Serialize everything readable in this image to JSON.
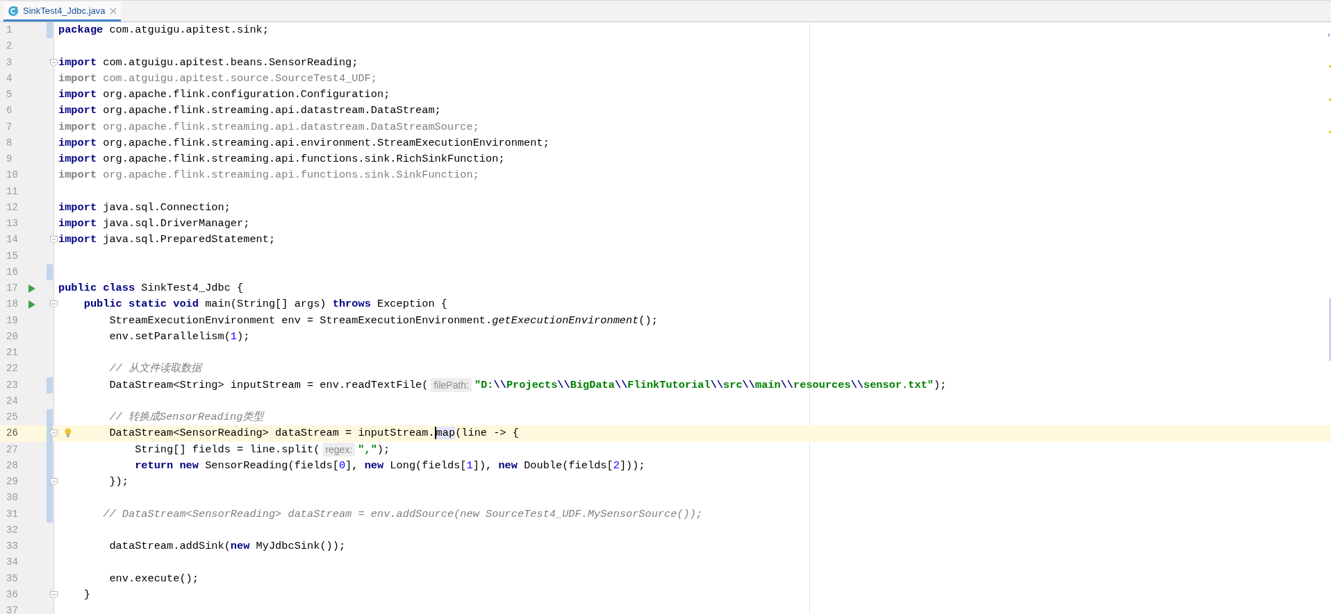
{
  "tabs": [
    {
      "label": "SinkTest4_Jdbc.java",
      "selected": true
    }
  ],
  "lines": [
    {
      "number": "1",
      "changed": true,
      "fold": false,
      "run": false,
      "current": false,
      "bulb": false,
      "tokens": [
        {
          "kind": "keyword",
          "text": "package"
        },
        {
          "kind": "plain",
          "text": " com.atguigu.apitest.sink;"
        }
      ]
    },
    {
      "number": "2",
      "changed": false,
      "fold": false,
      "run": false,
      "current": false,
      "bulb": false
    },
    {
      "number": "3",
      "changed": false,
      "fold": true,
      "run": false,
      "current": false,
      "bulb": false,
      "tokens": [
        {
          "kind": "keyword",
          "text": "import"
        },
        {
          "kind": "plain",
          "text": " com.atguigu.apitest.beans.SensorReading;"
        }
      ]
    },
    {
      "number": "4",
      "changed": false,
      "fold": false,
      "run": false,
      "current": false,
      "bulb": false,
      "tokens": [
        {
          "kind": "unused_keyword",
          "text": "import"
        },
        {
          "kind": "unused",
          "text": " com.atguigu.apitest.source.SourceTest4_UDF;"
        }
      ]
    },
    {
      "number": "5",
      "changed": false,
      "fold": false,
      "run": false,
      "current": false,
      "bulb": false,
      "tokens": [
        {
          "kind": "keyword",
          "text": "import"
        },
        {
          "kind": "plain",
          "text": " org.apache.flink.configuration.Configuration;"
        }
      ]
    },
    {
      "number": "6",
      "changed": false,
      "fold": false,
      "run": false,
      "current": false,
      "bulb": false,
      "tokens": [
        {
          "kind": "keyword",
          "text": "import"
        },
        {
          "kind": "plain",
          "text": " org.apache.flink.streaming.api.datastream.DataStream;"
        }
      ]
    },
    {
      "number": "7",
      "changed": false,
      "fold": false,
      "run": false,
      "current": false,
      "bulb": false,
      "tokens": [
        {
          "kind": "unused_keyword",
          "text": "import"
        },
        {
          "kind": "unused",
          "text": " org.apache.flink.streaming.api.datastream.DataStreamSource;"
        }
      ]
    },
    {
      "number": "8",
      "changed": false,
      "fold": false,
      "run": false,
      "current": false,
      "bulb": false,
      "tokens": [
        {
          "kind": "keyword",
          "text": "import"
        },
        {
          "kind": "plain",
          "text": " org.apache.flink.streaming.api.environment.StreamExecutionEnvironment;"
        }
      ]
    },
    {
      "number": "9",
      "changed": false,
      "fold": false,
      "run": false,
      "current": false,
      "bulb": false,
      "tokens": [
        {
          "kind": "keyword",
          "text": "import"
        },
        {
          "kind": "plain",
          "text": " org.apache.flink.streaming.api.functions.sink.RichSinkFunction;"
        }
      ]
    },
    {
      "number": "10",
      "changed": false,
      "fold": false,
      "run": false,
      "current": false,
      "bulb": false,
      "tokens": [
        {
          "kind": "unused_keyword",
          "text": "import"
        },
        {
          "kind": "unused",
          "text": " org.apache.flink.streaming.api.functions.sink.SinkFunction;"
        }
      ]
    },
    {
      "number": "11",
      "changed": false,
      "fold": false,
      "run": false,
      "current": false,
      "bulb": false
    },
    {
      "number": "12",
      "changed": false,
      "fold": false,
      "run": false,
      "current": false,
      "bulb": false,
      "tokens": [
        {
          "kind": "keyword",
          "text": "import"
        },
        {
          "kind": "plain",
          "text": " java.sql.Connection;"
        }
      ]
    },
    {
      "number": "13",
      "changed": false,
      "fold": false,
      "run": false,
      "current": false,
      "bulb": false,
      "tokens": [
        {
          "kind": "keyword",
          "text": "import"
        },
        {
          "kind": "plain",
          "text": " java.sql.DriverManager;"
        }
      ]
    },
    {
      "number": "14",
      "changed": false,
      "fold": true,
      "run": false,
      "current": false,
      "bulb": false,
      "tokens": [
        {
          "kind": "keyword",
          "text": "import"
        },
        {
          "kind": "plain",
          "text": " java.sql.PreparedStatement;"
        }
      ]
    },
    {
      "number": "15",
      "changed": false,
      "fold": false,
      "run": false,
      "current": false,
      "bulb": false
    },
    {
      "number": "16",
      "changed": true,
      "fold": false,
      "run": false,
      "current": false,
      "bulb": false
    },
    {
      "number": "17",
      "changed": false,
      "fold": false,
      "run": true,
      "current": false,
      "bulb": false,
      "tokens": [
        {
          "kind": "keyword",
          "text": "public class"
        },
        {
          "kind": "plain",
          "text": " SinkTest4_Jdbc {"
        }
      ]
    },
    {
      "number": "18",
      "changed": false,
      "fold": true,
      "run": true,
      "current": false,
      "bulb": false,
      "tokens": [
        {
          "kind": "keyword",
          "text": "    public static void"
        },
        {
          "kind": "plain",
          "text": " main(String[] args) "
        },
        {
          "kind": "keyword",
          "text": "throws"
        },
        {
          "kind": "plain",
          "text": " Exception {"
        }
      ]
    },
    {
      "number": "19",
      "changed": false,
      "fold": false,
      "run": false,
      "current": false,
      "bulb": false,
      "tokens": [
        {
          "kind": "plain",
          "text": "        StreamExecutionEnvironment env = StreamExecutionEnvironment."
        },
        {
          "kind": "static",
          "text": "getExecutionEnvironment"
        },
        {
          "kind": "plain",
          "text": "();"
        }
      ]
    },
    {
      "number": "20",
      "changed": false,
      "fold": false,
      "run": false,
      "current": false,
      "bulb": false,
      "tokens": [
        {
          "kind": "plain",
          "text": "        env.setParallelism("
        },
        {
          "kind": "number",
          "text": "1"
        },
        {
          "kind": "plain",
          "text": ");"
        }
      ]
    },
    {
      "number": "21",
      "changed": false,
      "fold": false,
      "run": false,
      "current": false,
      "bulb": false
    },
    {
      "number": "22",
      "changed": false,
      "fold": false,
      "run": false,
      "current": false,
      "bulb": false,
      "tokens": [
        {
          "kind": "comment",
          "text": "        // 从文件读取数据"
        }
      ]
    },
    {
      "number": "23",
      "changed": true,
      "fold": false,
      "run": false,
      "current": false,
      "bulb": false,
      "tokens": [
        {
          "kind": "plain",
          "text": "        DataStream<String> inputStream = env.readTextFile("
        },
        {
          "kind": "hint",
          "text": "filePath:"
        },
        {
          "kind": "string",
          "text": "\"D:"
        },
        {
          "kind": "escape",
          "text": "\\\\"
        },
        {
          "kind": "string",
          "text": "Projects"
        },
        {
          "kind": "escape",
          "text": "\\\\"
        },
        {
          "kind": "string",
          "text": "BigData"
        },
        {
          "kind": "escape",
          "text": "\\\\"
        },
        {
          "kind": "string",
          "text": "FlinkTutorial"
        },
        {
          "kind": "escape",
          "text": "\\\\"
        },
        {
          "kind": "string",
          "text": "src"
        },
        {
          "kind": "escape",
          "text": "\\\\"
        },
        {
          "kind": "string",
          "text": "main"
        },
        {
          "kind": "escape",
          "text": "\\\\"
        },
        {
          "kind": "string",
          "text": "resources"
        },
        {
          "kind": "escape",
          "text": "\\\\"
        },
        {
          "kind": "string",
          "text": "sensor.txt\""
        },
        {
          "kind": "plain",
          "text": ");"
        }
      ]
    },
    {
      "number": "24",
      "changed": false,
      "fold": false,
      "run": false,
      "current": false,
      "bulb": false
    },
    {
      "number": "25",
      "changed": true,
      "fold": false,
      "run": false,
      "current": false,
      "bulb": false,
      "tokens": [
        {
          "kind": "comment",
          "text": "        // 转换成SensorReading类型"
        }
      ]
    },
    {
      "number": "26",
      "changed": true,
      "fold": true,
      "run": false,
      "current": true,
      "bulb": true,
      "tokens": [
        {
          "kind": "plain",
          "text": "        DataStream<SensorReading> dataStream = inputStream."
        },
        {
          "kind": "caret_match",
          "text": "map"
        },
        {
          "kind": "plain",
          "text": "(line -> {"
        }
      ]
    },
    {
      "number": "27",
      "changed": true,
      "fold": false,
      "run": false,
      "current": false,
      "bulb": false,
      "tokens": [
        {
          "kind": "plain",
          "text": "            String[] fields = line.split("
        },
        {
          "kind": "hint",
          "text": "regex:"
        },
        {
          "kind": "string",
          "text": "\",\""
        },
        {
          "kind": "plain",
          "text": ");"
        }
      ]
    },
    {
      "number": "28",
      "changed": true,
      "fold": false,
      "run": false,
      "current": false,
      "bulb": false,
      "tokens": [
        {
          "kind": "keyword",
          "text": "            return new"
        },
        {
          "kind": "plain",
          "text": " SensorReading(fields["
        },
        {
          "kind": "number",
          "text": "0"
        },
        {
          "kind": "plain",
          "text": "], "
        },
        {
          "kind": "keyword",
          "text": "new"
        },
        {
          "kind": "plain",
          "text": " Long(fields["
        },
        {
          "kind": "number",
          "text": "1"
        },
        {
          "kind": "plain",
          "text": "]), "
        },
        {
          "kind": "keyword",
          "text": "new"
        },
        {
          "kind": "plain",
          "text": " Double(fields["
        },
        {
          "kind": "number",
          "text": "2"
        },
        {
          "kind": "plain",
          "text": "]));"
        }
      ]
    },
    {
      "number": "29",
      "changed": true,
      "fold": true,
      "run": false,
      "current": false,
      "bulb": false,
      "tokens": [
        {
          "kind": "plain",
          "text": "        });"
        }
      ]
    },
    {
      "number": "30",
      "changed": true,
      "fold": false,
      "run": false,
      "current": false,
      "bulb": false
    },
    {
      "number": "31",
      "changed": true,
      "fold": false,
      "run": false,
      "current": false,
      "bulb": false,
      "tokens": [
        {
          "kind": "comment",
          "text": "       // DataStream<SensorReading> dataStream = env.addSource(new SourceTest4_UDF.MySensorSource());"
        }
      ]
    },
    {
      "number": "32",
      "changed": false,
      "fold": false,
      "run": false,
      "current": false,
      "bulb": false
    },
    {
      "number": "33",
      "changed": false,
      "fold": false,
      "run": false,
      "current": false,
      "bulb": false,
      "tokens": [
        {
          "kind": "plain",
          "text": "        dataStream.addSink("
        },
        {
          "kind": "keyword",
          "text": "new"
        },
        {
          "kind": "plain",
          "text": " MyJdbcSink());"
        }
      ]
    },
    {
      "number": "34",
      "changed": false,
      "fold": false,
      "run": false,
      "current": false,
      "bulb": false
    },
    {
      "number": "35",
      "changed": false,
      "fold": false,
      "run": false,
      "current": false,
      "bulb": false,
      "tokens": [
        {
          "kind": "plain",
          "text": "        env.execute();"
        }
      ]
    },
    {
      "number": "36",
      "changed": false,
      "fold": true,
      "run": false,
      "current": false,
      "bulb": false,
      "tokens": [
        {
          "kind": "plain",
          "text": "    }"
        }
      ]
    },
    {
      "number": "37",
      "changed": false,
      "fold": false,
      "run": false,
      "current": false,
      "bulb": false
    }
  ]
}
